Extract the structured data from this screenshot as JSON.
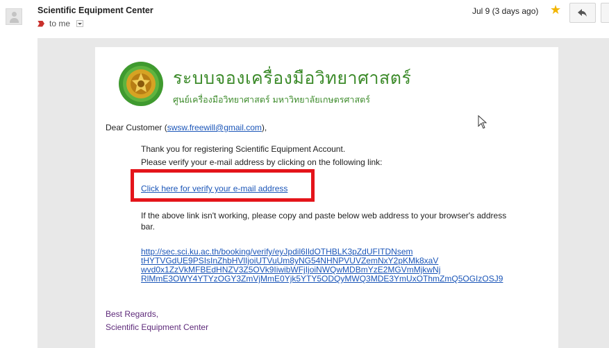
{
  "header": {
    "sender_name": "Scientific Equipment Center",
    "recipient_text": "to me",
    "date": "Jul 9 (3 days ago)"
  },
  "icons": {
    "avatar": "person-icon",
    "importance": "importance-marker-icon",
    "details": "chevron-down-icon",
    "star": "star-icon",
    "reply": "reply-icon"
  },
  "colors": {
    "brand_green": "#3d8b2b",
    "link_blue": "#1a55b8",
    "highlight_red": "#e4141a",
    "star_yellow": "#f2b500",
    "regards_purple": "#5e2a7a"
  },
  "email": {
    "brand_title": "ระบบจองเครื่องมือวิทยาศาสตร์",
    "brand_subtitle": "ศูนย์เครื่องมือวิทยาศาสตร์ มหาวิทยาลัยเกษตรศาสตร์",
    "greeting_prefix": "Dear Customer (",
    "greeting_email": "swsw.freewill@gmail.com",
    "greeting_suffix": "),",
    "thanks_line": "Thank you for registering Scientific Equipment Account.",
    "verify_line": "Please verify your e-mail address by clicking on the following link:",
    "verify_link": "Click here for verify your e-mail address",
    "fallback_line1": "If the above link isn't working, please copy and paste below web address to your browser's address",
    "fallback_line2": "bar.",
    "url_lines": [
      "http://sec.sci.ku.ac.th/booking/verify/eyJpdil6IldOTHBLK3pZdUFITDNsem",
      "tHYTVGdUE9PSIsInZhbHVlIjoiUTVuUm8yNG54NHNPVUVZemNxY2pKMk8xaV",
      "wvd0x1ZzVkMFBEdHNZV3Z5OVk9IiwibWFjIjoiNWQwMDBmYzE2MGVmMjkwNj",
      "RlMmE3OWY4YTYzOGY3ZmVjMmE0Yjk5YTY5ODQyMWQ3MDE3YmUxOThmZmQ5OGIzOSJ9"
    ],
    "closing": "Best Regards,",
    "signature": "Scientific Equipment Center"
  }
}
